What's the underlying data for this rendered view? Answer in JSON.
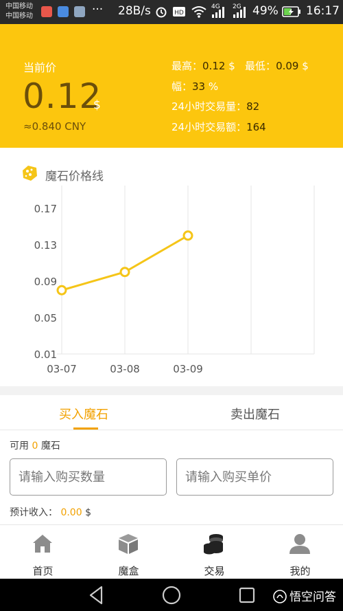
{
  "status_bar": {
    "carrier_1": "中国移动",
    "carrier_2": "中国移动",
    "speed": "28B/s",
    "net_4g": "4G",
    "net_2g": "2G",
    "battery": "49%",
    "time": "16:17"
  },
  "header": {
    "label": "当前价",
    "price": "0.12",
    "currency": "$",
    "cny": "≈0.840 CNY",
    "high_label": "最高：",
    "high_value": "0.12",
    "high_unit": " $",
    "low_label": "最低：",
    "low_value": "0.09",
    "low_unit": " $",
    "range_label": "幅：",
    "range_value": "33",
    "range_unit": " %",
    "volume_label": "24小时交易量：",
    "volume_value": "82",
    "amount_label": "24小时交易额：",
    "amount_value": "164"
  },
  "chart_title": "魔石价格线",
  "chart_data": {
    "type": "line",
    "title": "魔石价格线",
    "x": [
      "03-07",
      "03-08",
      "03-09"
    ],
    "values": [
      0.08,
      0.1,
      0.14
    ],
    "ylim": [
      0.01,
      0.17
    ],
    "yticks": [
      "0.17",
      "0.13",
      "0.09",
      "0.05",
      "0.01"
    ],
    "grid": true,
    "color": "#f5c518"
  },
  "trade": {
    "tab_buy": "买入魔石",
    "tab_sell": "卖出魔石",
    "avail_prefix": "可用 ",
    "avail_value": "0",
    "avail_suffix": " 魔石",
    "qty_placeholder": "请输入购买数量",
    "price_placeholder": "请输入购买单价",
    "est_label": "预计收入： ",
    "est_value": "0.00",
    "est_unit": " $"
  },
  "nav": {
    "home": "首页",
    "box": "魔盒",
    "trade": "交易",
    "mine": "我的"
  },
  "watermark": "悟空问答",
  "colors": {
    "brand": "#fcc60e",
    "accent": "#f2a100",
    "line": "#f5c518"
  }
}
